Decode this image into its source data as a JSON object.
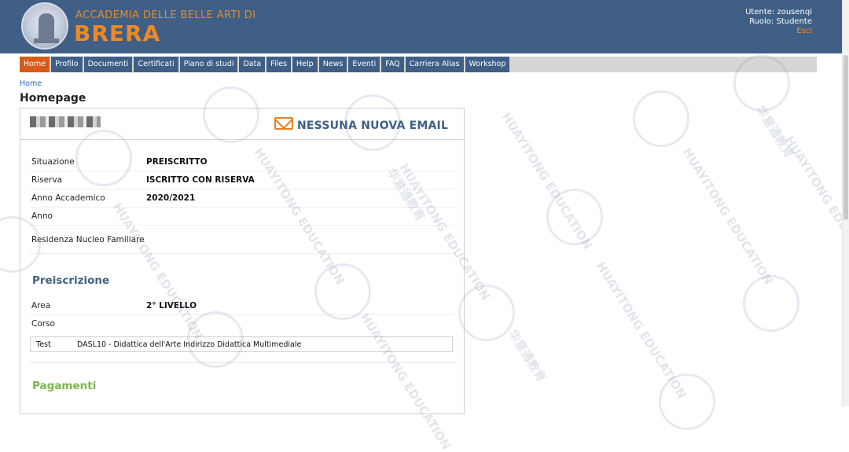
{
  "header": {
    "brand_top": "ACCADEMIA DELLE BELLE ARTI DI",
    "brand_main": "BRERA",
    "user_line": "Utente: zousenqi",
    "role_line": "Ruolo:  Studente",
    "logout": "Esci"
  },
  "nav": [
    {
      "label": "Home",
      "active": true
    },
    {
      "label": "Profilo"
    },
    {
      "label": "Documenti"
    },
    {
      "label": "Certificati"
    },
    {
      "label": "Piano di studi"
    },
    {
      "label": "Data"
    },
    {
      "label": "Files"
    },
    {
      "label": "Help"
    },
    {
      "label": "News"
    },
    {
      "label": "Eventi"
    },
    {
      "label": "FAQ"
    },
    {
      "label": "Carriera Alias"
    },
    {
      "label": "Workshop"
    }
  ],
  "breadcrumb": "Home",
  "page_title": "Homepage",
  "mail_status": "NESSUNA NUOVA EMAIL",
  "info": {
    "situazione_label": "Situazione",
    "situazione_value": "PREISCRITTO",
    "riserva_label": "Riserva",
    "riserva_value": "ISCRITTO CON RISERVA",
    "anno_acc_label": "Anno Accademico",
    "anno_acc_value": "2020/2021",
    "anno_label": "Anno",
    "anno_value": "",
    "residenza_label": "Residenza Nucleo Familiare",
    "residenza_value": ""
  },
  "preiscrizione": {
    "title": "Preiscrizione",
    "area_label": "Area",
    "area_value": "2° LIVELLO",
    "corso_label": "Corso",
    "test_label": "Test",
    "test_value": "DASL10 - Didattica dell'Arte Indirizzo Didattica Multimediale"
  },
  "pagamenti_title": "Pagamenti",
  "watermark_text": "HUAYITONG EDUCATION",
  "watermark_cn": "华意通教育",
  "colors": {
    "header": "#3f5f86",
    "accent": "#ee8a24",
    "nav_active": "#d85a1a",
    "green": "#7ab648"
  }
}
